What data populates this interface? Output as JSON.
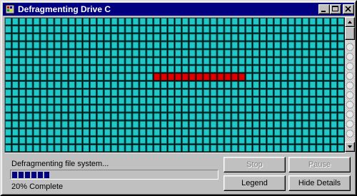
{
  "window": {
    "title": "Defragmenting Drive C",
    "controls": [
      "minimize",
      "maximize",
      "close"
    ]
  },
  "disk_map": {
    "columns": 48,
    "rows": 17,
    "cluster_color": "#20c8c8",
    "cluster_border": "#006060",
    "reading_color": "#e00000",
    "reading_row": 7,
    "reading_start_col": 21,
    "reading_end_col": 33
  },
  "status": {
    "label": "Defragmenting file system...",
    "percent_text": "20% Complete",
    "progress_fraction": 0.2
  },
  "buttons": {
    "stop": "Stop",
    "pause": "Pause",
    "legend": "Legend",
    "hide_details": "Hide Details"
  },
  "colors": {
    "title_bar": "#000080",
    "face": "#c0c0c0",
    "progress_block": "#000080"
  },
  "icons": {
    "title_icon": "defrag-icon",
    "minimize": "minimize-icon",
    "maximize": "maximize-icon",
    "close": "close-icon",
    "scroll_up": "arrow-up-icon",
    "scroll_down": "arrow-down-icon"
  }
}
